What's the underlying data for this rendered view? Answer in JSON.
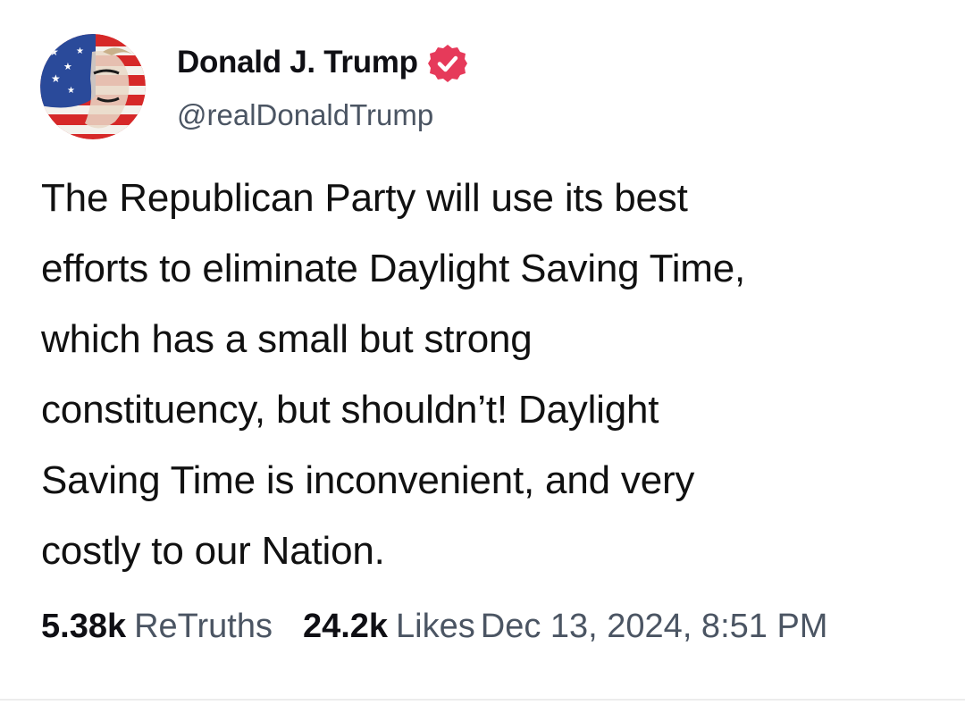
{
  "author": {
    "name": "Donald J. Trump",
    "handle": "@realDonaldTrump",
    "verified_icon": "verified-badge-icon",
    "verified_color": "#e63a5a"
  },
  "post": {
    "lines": [
      "The Republican Party will use its best",
      "efforts to eliminate Daylight Saving Time,",
      "which has a small but strong",
      "constituency, but shouldn’t! Daylight",
      "Saving Time is inconvenient, and very",
      "costly to our Nation."
    ]
  },
  "stats": {
    "retruths_count": "5.38k",
    "retruths_label": "ReTruths",
    "likes_count": "24.2k",
    "likes_label": "Likes",
    "timestamp": "Dec 13, 2024, 8:51 PM"
  }
}
